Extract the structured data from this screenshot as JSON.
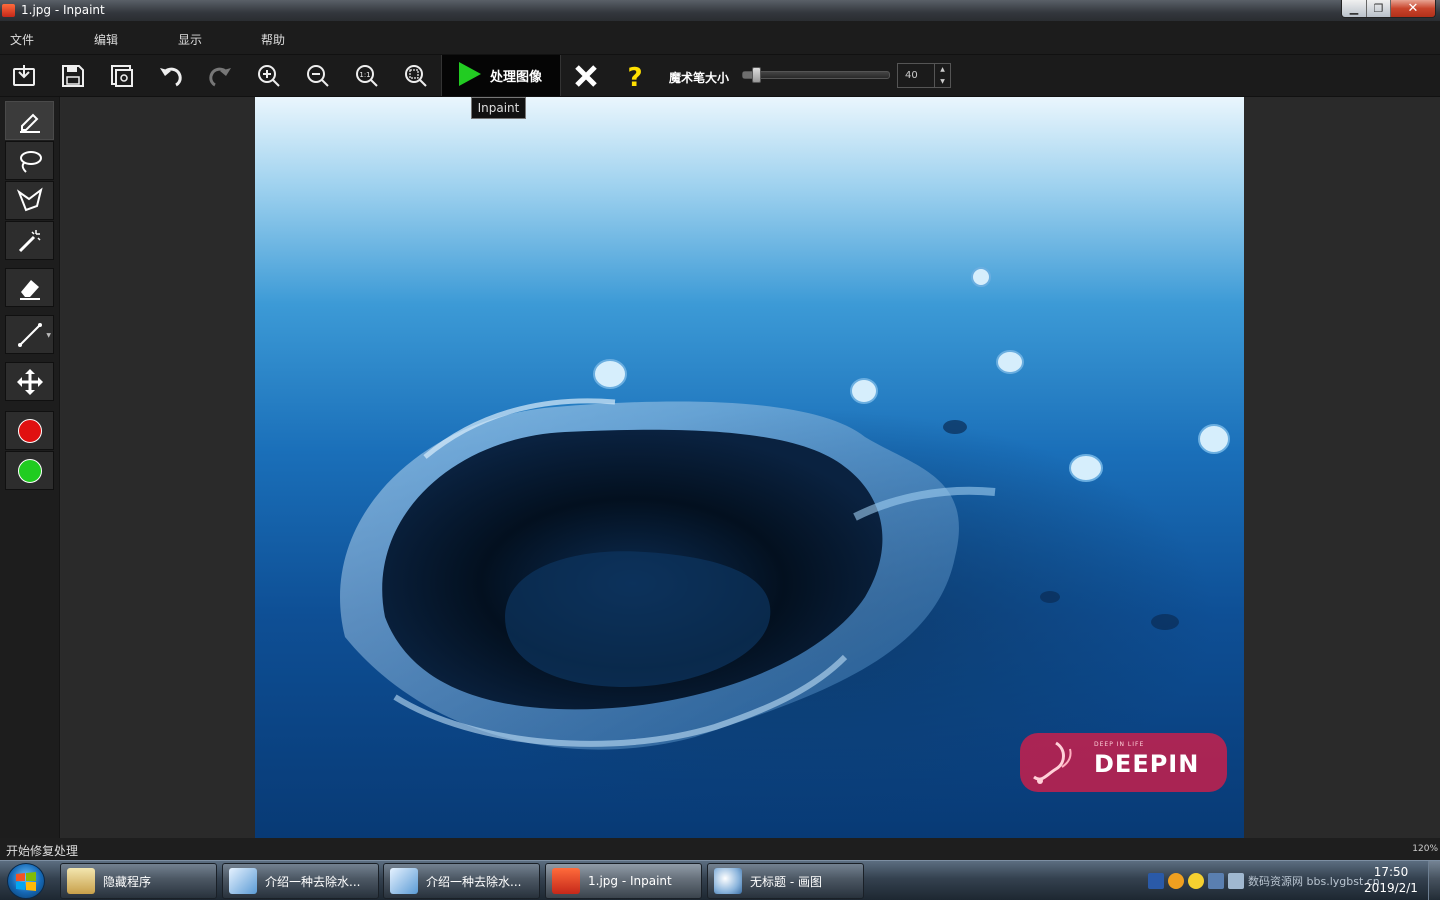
{
  "window": {
    "title": "1.jpg - Inpaint"
  },
  "window_buttons": {
    "minimize": "▁",
    "maximize": "❐",
    "close": "✕"
  },
  "menu": [
    "文件",
    "编辑",
    "显示",
    "帮助"
  ],
  "toolbar": {
    "process_label": "处理图像",
    "tooltip": "Inpaint",
    "wand_size_label": "魔术笔大小",
    "wand_size_value": "40",
    "wand_size_fraction": 0.1,
    "icons": [
      "open-icon",
      "save-icon",
      "save-as-icon",
      "undo-icon",
      "redo-icon",
      "zoom-in-icon",
      "zoom-out-icon",
      "zoom-actual-icon",
      "zoom-fit-icon",
      "play-icon",
      "cancel-icon",
      "help-icon"
    ]
  },
  "tools": [
    "marker-icon",
    "lasso-icon",
    "polygon-lasso-icon",
    "magic-wand-icon",
    "eraser-icon",
    "line-icon",
    "move-icon",
    "red-color",
    "green-color"
  ],
  "colors": {
    "accent_red": "#e01010",
    "accent_green": "#20cc20",
    "play_green": "#22cc22",
    "help_yellow": "#ffe000"
  },
  "watermark": {
    "tagline": "DEEP IN LIFE",
    "brand": "DEEPIN"
  },
  "status": {
    "message": "开始修复处理",
    "zoom": "120%"
  },
  "taskbar": {
    "items": [
      "隐藏程序",
      "介绍一种去除水...",
      "介绍一种去除水...",
      "1.jpg - Inpaint",
      "无标题 - 画图"
    ],
    "tray_overlay": "数码资源网 bbs.lygbst.cn",
    "time": "17:50",
    "date": "2019/2/1"
  }
}
